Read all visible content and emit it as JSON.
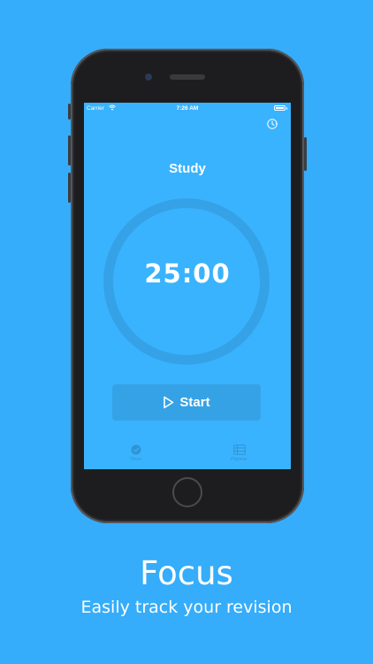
{
  "colors": {
    "background": "#35adfa",
    "screen": "#3ab3ff",
    "ring": "#35a2e8",
    "button": "#36a2e6",
    "tab_tint": "#2f93d2",
    "text": "#ffffff"
  },
  "status_bar": {
    "carrier": "Carrier",
    "time": "7:26 AM"
  },
  "header": {
    "settings_icon": "clock-arrow-icon"
  },
  "timer": {
    "mode": "Study",
    "display": "25:00",
    "progress": 0
  },
  "controls": {
    "start_label": "Start",
    "start_icon": "play-icon"
  },
  "tabs": [
    {
      "label": "Timer",
      "icon": "timer-icon",
      "selected": true
    },
    {
      "label": "Planner",
      "icon": "planner-icon",
      "selected": false
    }
  ],
  "caption": {
    "title": "Focus",
    "subtitle": "Easily track your revision"
  }
}
